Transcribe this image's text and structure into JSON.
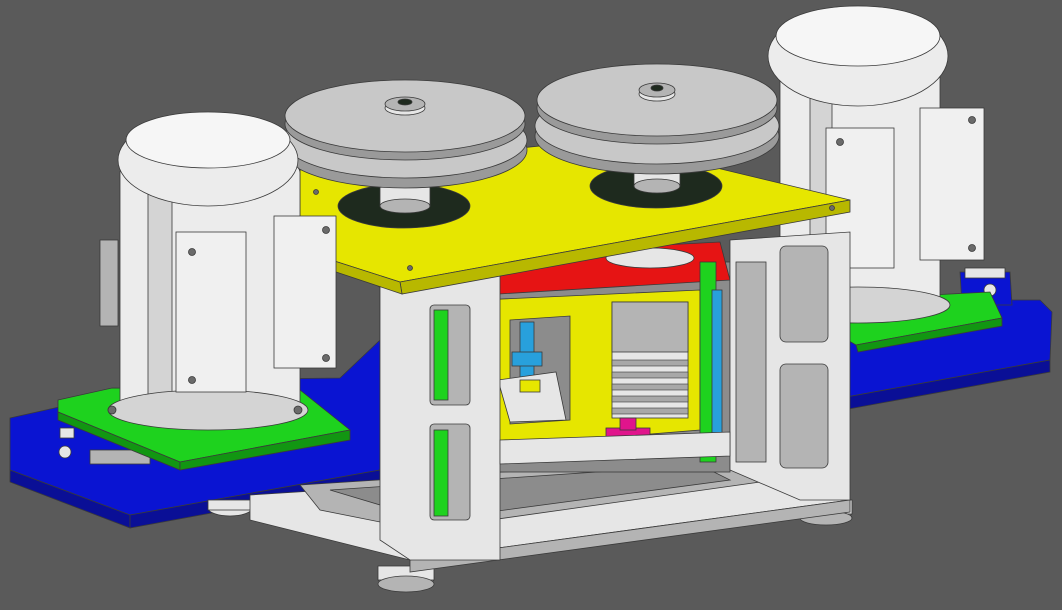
{
  "viewport": {
    "background": "#5a5a5a"
  },
  "palette": {
    "frame": "#e6e6e6",
    "frame_shadow": "#b4b4b4",
    "frame_dark": "#8c8c8c",
    "top_plate": "#e6e600",
    "top_plate_edge": "#b8b800",
    "base_rail": "#0a14d2",
    "base_rail_dark": "#0a0f96",
    "motor_mount": "#1ed21e",
    "motor_mount_edge": "#129612",
    "red_plate": "#e61414",
    "magenta": "#e0148c",
    "cyan_shaft": "#28a0dc",
    "motor_white": "#ececec",
    "pulley": "#c8c8c8",
    "dark_hole": "#1e2a1e"
  },
  "components": [
    {
      "name": "left-motor",
      "kind": "electric motor"
    },
    {
      "name": "right-motor",
      "kind": "electric motor"
    },
    {
      "name": "left-pulley",
      "kind": "double V-belt pulley"
    },
    {
      "name": "right-pulley",
      "kind": "double V-belt pulley"
    },
    {
      "name": "top-plate",
      "kind": "yellow mounting plate"
    },
    {
      "name": "main-frame",
      "kind": "white welded frame"
    },
    {
      "name": "base-rails",
      "kind": "blue slide rails"
    }
  ]
}
